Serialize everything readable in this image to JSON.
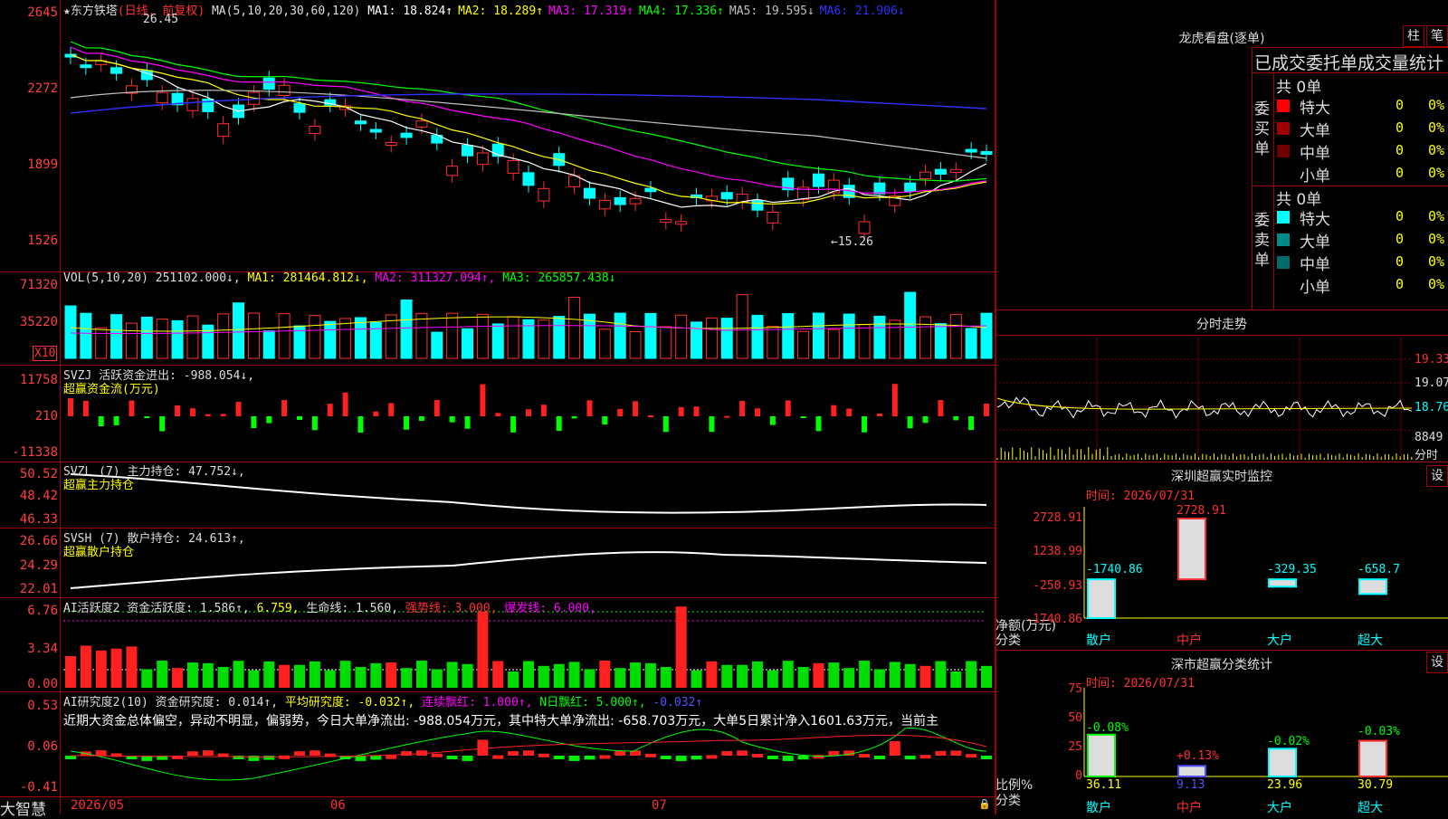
{
  "app": {
    "brand": "大智慧"
  },
  "main_chart": {
    "stock_name": "东方铁塔",
    "period": "(日线, 前复权)",
    "ma_label": "MA(5,10,20,30,60,120)",
    "ma_items": [
      {
        "label": "MA1: 18.824↑",
        "color": "#ffffff"
      },
      {
        "label": "MA2: 18.289↑",
        "color": "#ffff00"
      },
      {
        "label": "MA3: 17.319↑",
        "color": "#ff00ff"
      },
      {
        "label": "MA4: 17.336↑",
        "color": "#00ff00"
      },
      {
        "label": "MA5: 19.595↓",
        "color": "#c0c0c0"
      },
      {
        "label": "MA6: 21.906↓",
        "color": "#3030ff"
      }
    ],
    "y_labels": [
      "2645",
      "2272",
      "1899",
      "1526"
    ],
    "high_note": "26.45",
    "low_note": "←15.26"
  },
  "vol": {
    "header": "VOL(5,10,20)",
    "value": "251102.000↓,",
    "ma1": "MA1: 281464.812↓,",
    "ma2": "MA2: 311327.094↑,",
    "ma3": "MA3: 265857.438↓",
    "y_labels": [
      "71320",
      "35220"
    ],
    "unit": "X10"
  },
  "svzj": {
    "header": "SVZJ  活跃资金进出: -988.054↓,",
    "sub": "超赢资金流(万元)",
    "y_labels": [
      "11758",
      "210",
      "-11338"
    ]
  },
  "svzl": {
    "header": "SVZL (7) 主力持仓: 47.752↓,",
    "sub": "超赢主力持仓",
    "y_labels": [
      "50.52",
      "48.42",
      "46.33"
    ]
  },
  "svsh": {
    "header": "SVSH (7) 散户持仓: 24.613↑,",
    "sub": "超赢散户持仓",
    "y_labels": [
      "26.66",
      "24.29",
      "22.01"
    ]
  },
  "ai_active": {
    "h1": "AI活跃度2 资金活跃度: 1.586↑,",
    "h2": "6.759,",
    "h3": "生命线: 1.560,",
    "h4": "强势线: 3.000,",
    "h5": "爆发线: 6.000,",
    "y_labels": [
      "6.76",
      "3.34",
      "0.00"
    ]
  },
  "ai_research": {
    "h1": "AI研究度2(10) 资金研究度: 0.014↑,",
    "h2": "平均研究度: -0.032↑,",
    "h3": "连续飘红: 1.000↑,",
    "h4": "N日飘红: 5.000↑,",
    "h5": "-0.032↑",
    "text": "近期大资金总体偏空，异动不明显，偏弱势，今日大单净流出: -988.054万元，其中特大单净流出: -658.703万元，大单5日累计净入1601.63万元，当前主",
    "y_labels": [
      "0.53",
      "0.06",
      "-0.41"
    ]
  },
  "x_axis": {
    "labels": [
      "2026/05",
      "06",
      "07"
    ]
  },
  "right": {
    "lhb_title": "龙虎看盘(逐单)",
    "btn_zhu": "柱",
    "btn_bi": "笔",
    "stats_title": "已成交委托单成交量统计",
    "buy": {
      "label": "委买单",
      "total": "共 0单",
      "rows": [
        {
          "name": "特大",
          "val": "0",
          "pct": "0%",
          "color": "#ff0000"
        },
        {
          "name": "大单",
          "val": "0",
          "pct": "0%",
          "color": "#a00000"
        },
        {
          "name": "中单",
          "val": "0",
          "pct": "0%",
          "color": "#700000"
        },
        {
          "name": "小单",
          "val": "0",
          "pct": "0%",
          "color": "#000000"
        }
      ]
    },
    "sell": {
      "label": "委卖单",
      "total": "共 0单",
      "rows": [
        {
          "name": "特大",
          "val": "0",
          "pct": "0%",
          "color": "#00ffff"
        },
        {
          "name": "大单",
          "val": "0",
          "pct": "0%",
          "color": "#008b8b"
        },
        {
          "name": "中单",
          "val": "0",
          "pct": "0%",
          "color": "#006b6b"
        },
        {
          "name": "小单",
          "val": "0",
          "pct": "0%",
          "color": "#000000"
        }
      ]
    },
    "intraday": {
      "title": "分时走势",
      "y_labels": [
        "19.33",
        "19.07",
        "18.76"
      ],
      "vol_label": "8849",
      "vol_caption": "分时"
    },
    "monitor": {
      "title": "深圳超赢实时监控",
      "btn": "设",
      "time": "时间: 2026/07/31",
      "y_labels": [
        "2728.91",
        "1238.99",
        "-250.93",
        "-1740.86"
      ],
      "axis_caption1": "净额(万元)",
      "axis_caption2": "分类",
      "bars": [
        {
          "cat": "散户",
          "value": -1740.86,
          "label": "-1740.86"
        },
        {
          "cat": "中户",
          "value": 2728.91,
          "label": "2728.91"
        },
        {
          "cat": "大户",
          "value": -329.35,
          "label": "-329.35"
        },
        {
          "cat": "超大",
          "value": -658.7,
          "label": "-658.7"
        }
      ]
    },
    "classify": {
      "title": "深市超赢分类统计",
      "btn": "设",
      "time": "时间: 2026/07/31",
      "y_labels": [
        "75",
        "50",
        "25",
        "0"
      ],
      "axis_caption1": "比例%",
      "axis_caption2": "分类",
      "bars": [
        {
          "cat": "散户",
          "value": 36.11,
          "label": "36.11",
          "delta": "-0.08%"
        },
        {
          "cat": "中户",
          "value": 9.13,
          "label": "9.13",
          "delta": "+0.13%"
        },
        {
          "cat": "大户",
          "value": 23.96,
          "label": "23.96",
          "delta": "-0.02%"
        },
        {
          "cat": "超大",
          "value": 30.79,
          "label": "30.79",
          "delta": "-0.03%"
        }
      ]
    }
  }
}
